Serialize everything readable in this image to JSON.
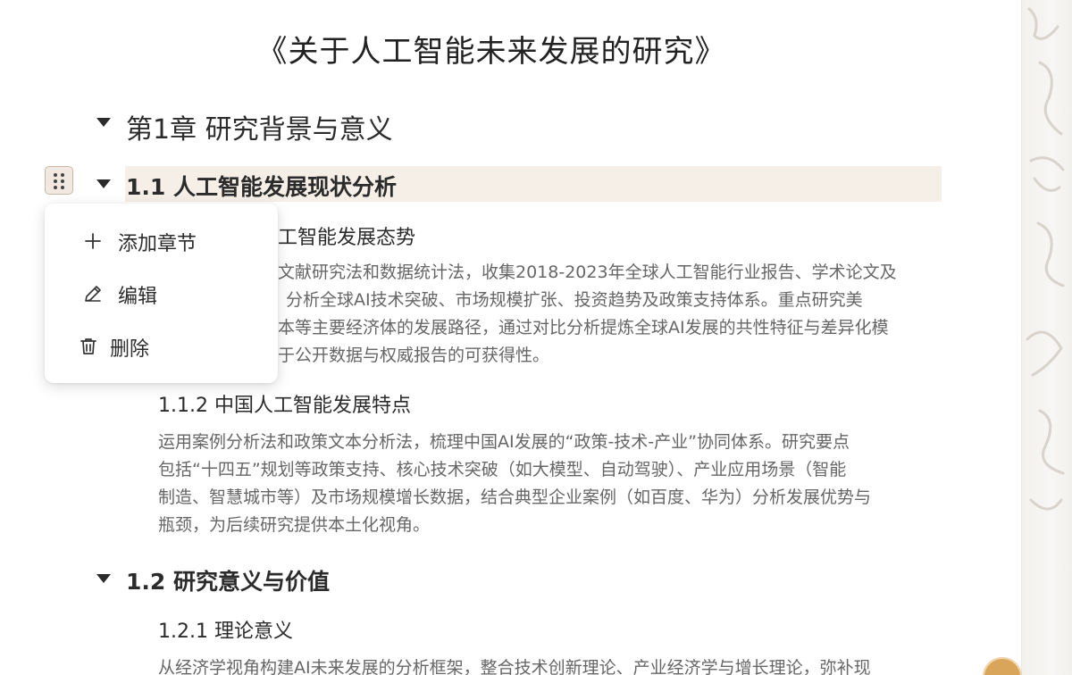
{
  "document": {
    "title": "《关于人工智能未来发展的研究》",
    "chapter_title": "第1章 研究背景与意义",
    "section_1_1": {
      "title": "1.1 人工智能发展现状分析",
      "sub_1": {
        "title_visible": "工智能发展态势",
        "lines": [
          "文献研究法和数据统计法，收集2018-2023年全球人工智能行业报告、学术论文及",
          "分析全球AI技术突破、市场规模扩张、投资趋势及政策支持体系。重点研究美",
          "本等主要经济体的发展路径，通过对比分析提炼全球AI发展的共性特征与差异化模",
          "于公开数据与权威报告的可获得性。"
        ]
      },
      "sub_2": {
        "title": "1.1.2 中国人工智能发展特点",
        "lines": [
          "运用案例分析法和政策文本分析法，梳理中国AI发展的“政策-技术-产业”协同体系。研究要点",
          "包括“十四五”规划等政策支持、核心技术突破（如大模型、自动驾驶）、产业应用场景（智能",
          "制造、智慧城市等）及市场规模增长数据，结合典型企业案例（如百度、华为）分析发展优势与",
          "瓶颈，为后续研究提供本土化视角。"
        ]
      }
    },
    "section_1_2": {
      "title": "1.2 研究意义与价值",
      "sub_1": {
        "title": "1.2.1 理论意义",
        "lines": [
          "从经济学视角构建AI未来发展的分析框架，整合技术创新理论、产业经济学与增长理论，弥补现"
        ]
      }
    }
  },
  "context_menu": {
    "items": [
      {
        "label": "添加章节",
        "icon": "plus-icon"
      },
      {
        "label": "编辑",
        "icon": "pencil-icon"
      },
      {
        "label": "删除",
        "icon": "trash-icon"
      }
    ]
  },
  "colors": {
    "highlight_row": "#f5efe8",
    "body_text": "#666666",
    "heading_text": "#2b2b2b",
    "handle_border": "#c9b8a6",
    "badge": "#d9a55a"
  }
}
